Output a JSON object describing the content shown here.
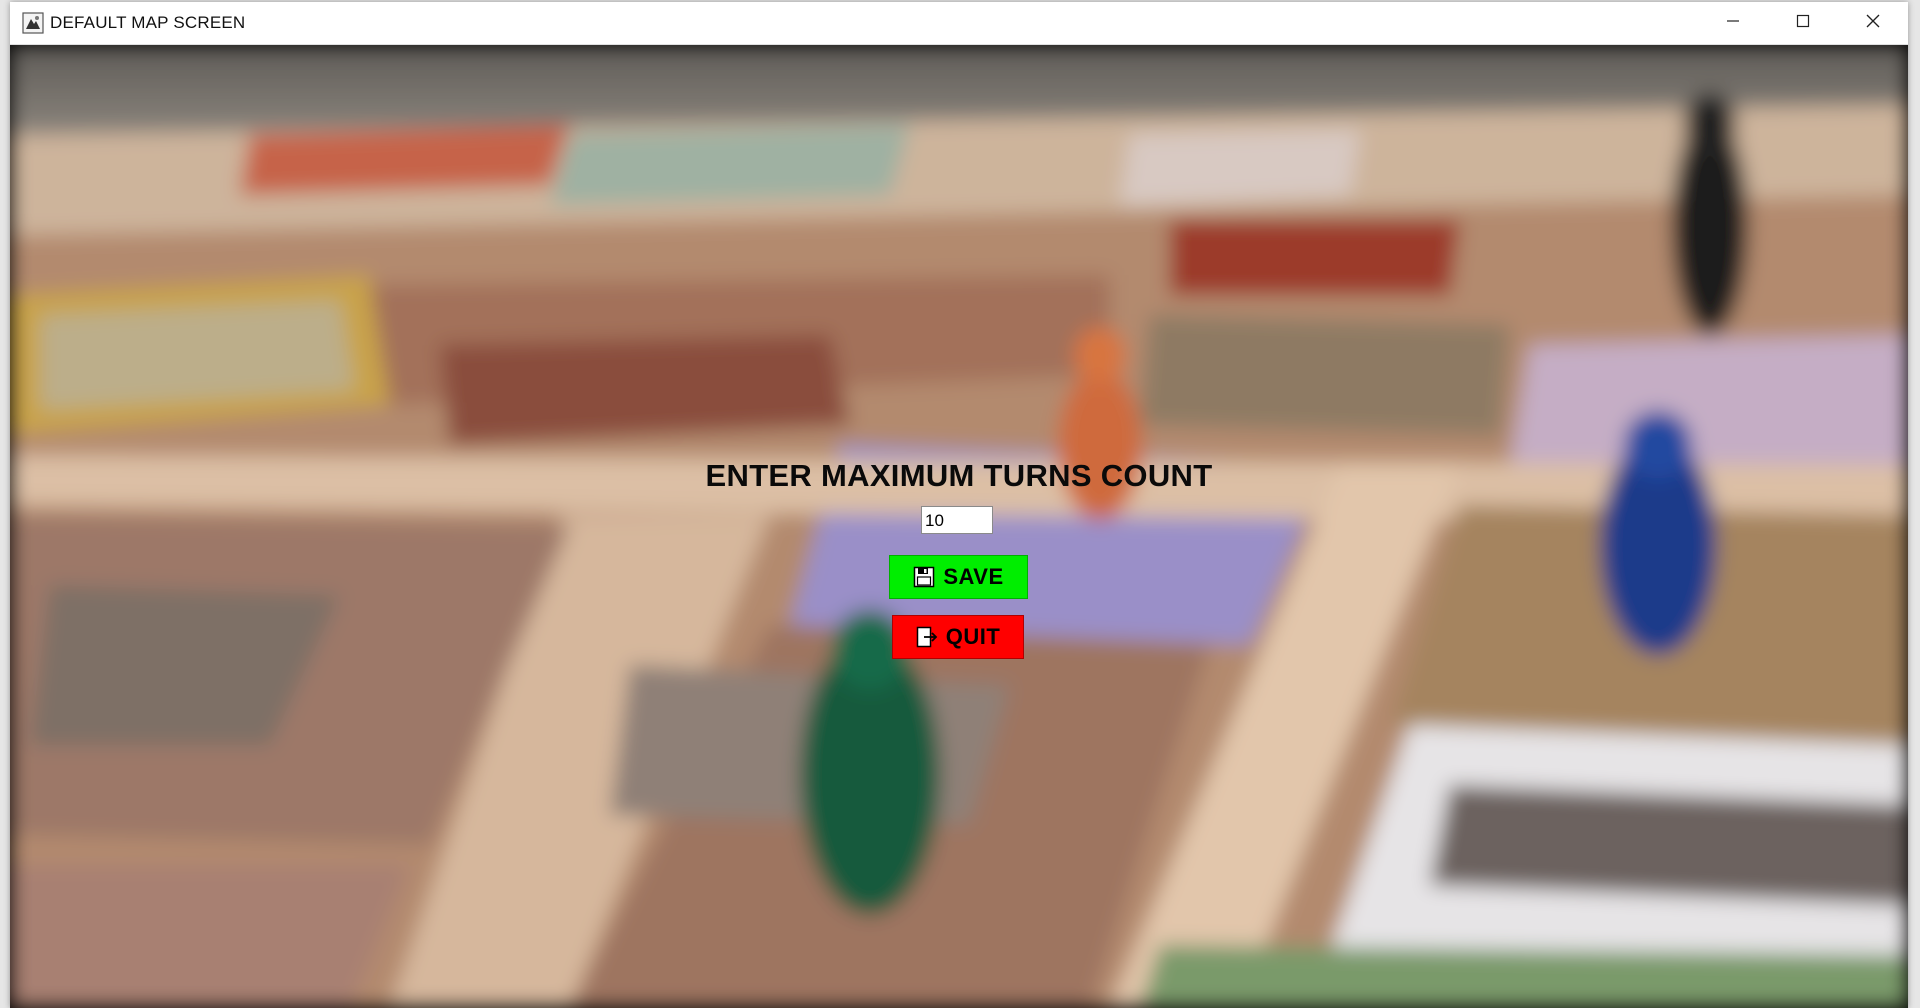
{
  "window": {
    "title": "DEFAULT MAP SCREEN",
    "controls": [
      "minimize",
      "maximize",
      "close"
    ]
  },
  "dialog": {
    "prompt": "ENTER MAXIMUM TURNS COUNT",
    "turns_input_value": "10",
    "save_label": "SAVE",
    "quit_label": "QUIT"
  },
  "icons": {
    "app": "app-icon",
    "minimize": "minimize-icon",
    "maximize": "maximize-icon",
    "close": "close-icon",
    "save": "floppy-disk-icon",
    "quit": "exit-icon"
  },
  "colors": {
    "save_button": "#00ee00",
    "quit_button": "#ff0000",
    "titlebar": "#ffffff",
    "prompt_text": "#0a0a0a"
  }
}
